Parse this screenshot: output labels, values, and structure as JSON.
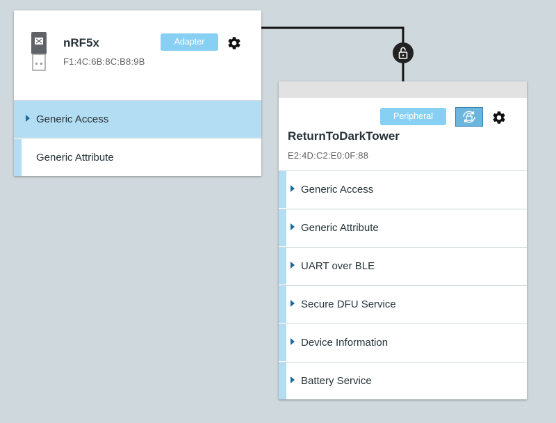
{
  "adapter": {
    "name": "nRF5x",
    "address": "F1:4C:6B:8C:B8:9B",
    "role_label": "Adapter",
    "icon": "usb-dongle-icon",
    "services": [
      {
        "label": "Generic Access",
        "selected": true
      },
      {
        "label": "Generic Attribute",
        "selected": false
      }
    ]
  },
  "peripheral": {
    "name": "ReturnToDarkTower",
    "address": "E2:4D:C2:E0:0F:88",
    "role_label": "Peripheral",
    "security_icon": "security-lock-refresh-icon",
    "services": [
      {
        "label": "Generic Access"
      },
      {
        "label": "Generic Attribute"
      },
      {
        "label": "UART over BLE"
      },
      {
        "label": "Secure DFU Service"
      },
      {
        "label": "Device Information"
      },
      {
        "label": "Battery Service"
      }
    ]
  },
  "connection": {
    "icon": "unlocked-padlock-icon"
  },
  "colors": {
    "background": "#cfd8dc",
    "badge": "#87d0f3",
    "selected_row": "#b3ddf2",
    "caret": "#1c6a9a"
  }
}
